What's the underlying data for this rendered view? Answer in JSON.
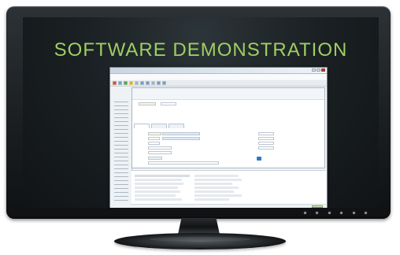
{
  "headline": "SOFTWARE DEMONSTRATION",
  "window": {
    "title": "",
    "menu": []
  },
  "form": {
    "tabs": [],
    "labels": []
  },
  "list": {
    "rows": []
  },
  "colors": {
    "headline": "#9fce63",
    "monitor": "#1c2023",
    "window_border": "#6f7b88",
    "button_blue": "#2f78c4"
  }
}
